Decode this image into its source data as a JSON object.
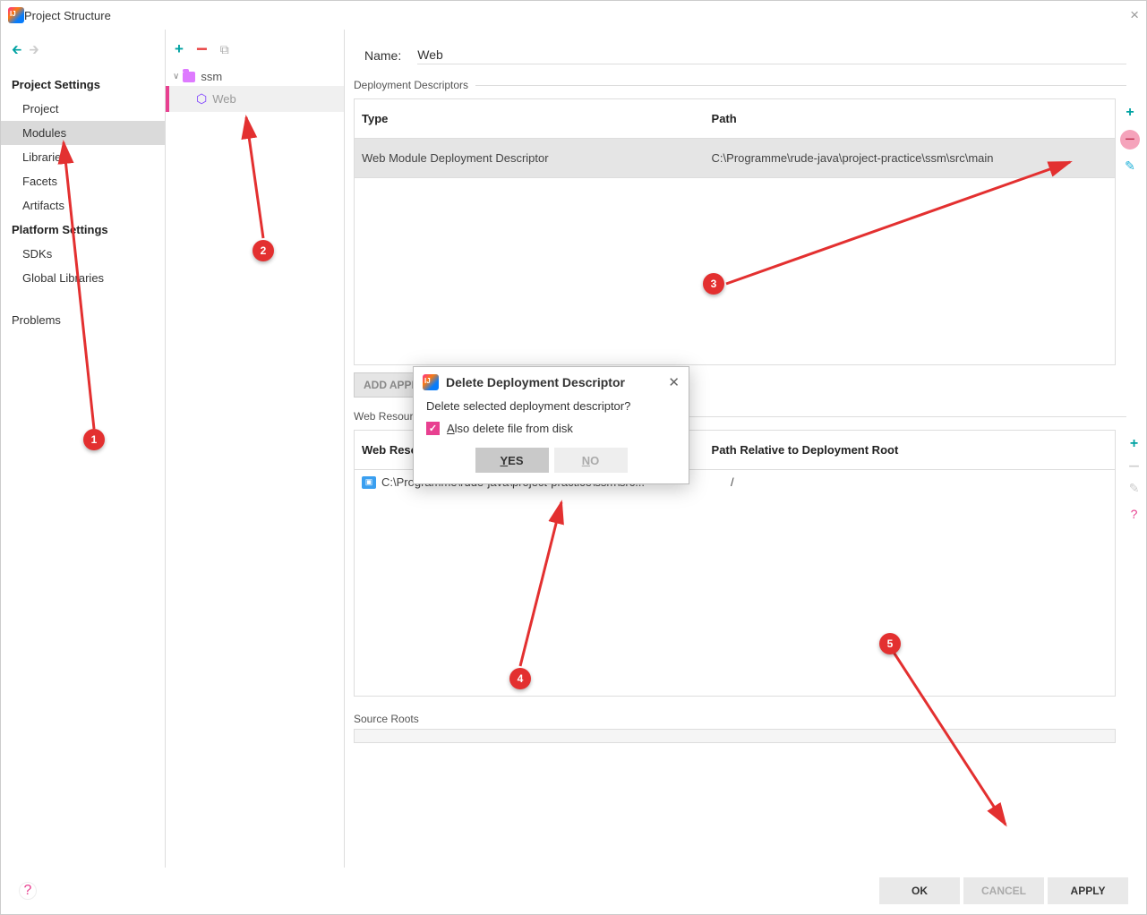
{
  "titlebar": {
    "title": "Project Structure"
  },
  "sidebar": {
    "headers": {
      "project": "Project Settings",
      "platform": "Platform Settings"
    },
    "items": {
      "project": "Project",
      "modules": "Modules",
      "libraries": "Libraries",
      "facets": "Facets",
      "artifacts": "Artifacts",
      "sdks": "SDKs",
      "globalLibs": "Global Libraries",
      "problems": "Problems"
    }
  },
  "tree": {
    "root": "ssm",
    "child": "Web"
  },
  "content": {
    "nameLabel": "Name:",
    "nameValue": "Web",
    "descriptors": {
      "title": "Deployment Descriptors",
      "cols": {
        "type": "Type",
        "path": "Path"
      },
      "row": {
        "type": "Web Module Deployment Descriptor",
        "path": "C:\\Programme\\rude-java\\project-practice\\ssm\\src\\main"
      },
      "addBtn": "ADD APPLICATION SERVER SPECIFIC DESCRIPTOR..."
    },
    "resources": {
      "title": "Web Resource Directories",
      "cols": {
        "dir": "Web Resource Directory",
        "rel": "Path Relative to Deployment Root"
      },
      "row": {
        "dir": "C:\\Programme\\rude-java\\project-practice\\ssm\\src...",
        "rel": "/"
      }
    },
    "sourceRoots": "Source Roots"
  },
  "dialog": {
    "title": "Delete Deployment Descriptor",
    "msg": "Delete selected deployment descriptor?",
    "chk": "Also delete file from disk",
    "yes": "YES",
    "no": "NO"
  },
  "footer": {
    "ok": "OK",
    "cancel": "CANCEL",
    "apply": "APPLY"
  },
  "markers": {
    "m1": "1",
    "m2": "2",
    "m3": "3",
    "m4": "4",
    "m5": "5"
  }
}
